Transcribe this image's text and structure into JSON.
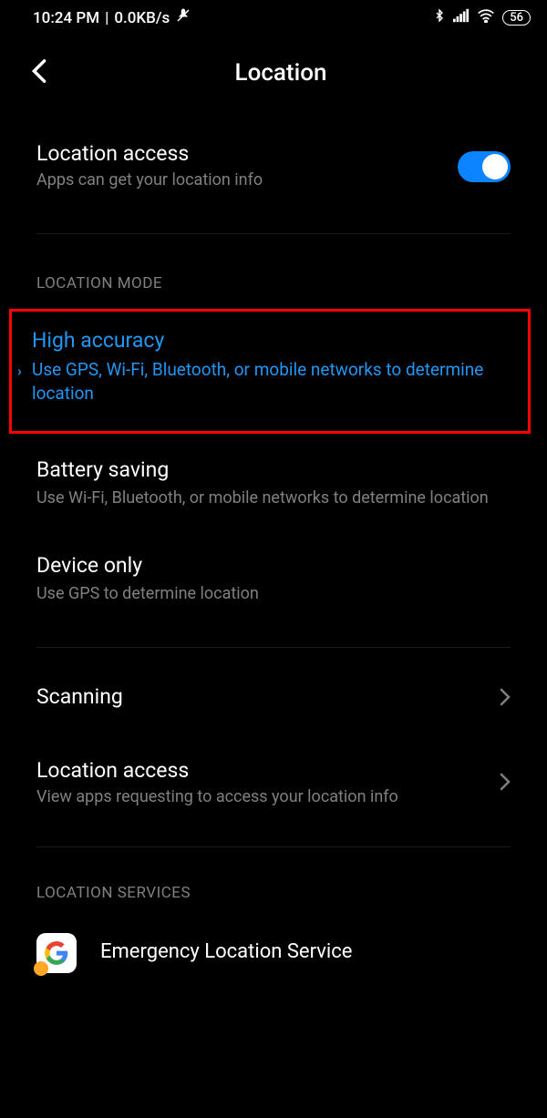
{
  "status": {
    "time": "10:24 PM",
    "speed": "0.0KB/s",
    "battery": "56"
  },
  "header": {
    "title": "Location"
  },
  "location_access": {
    "title": "Location access",
    "subtitle": "Apps can get your location info"
  },
  "sections": {
    "mode_header": "LOCATION MODE",
    "services_header": "LOCATION SERVICES"
  },
  "modes": {
    "high_accuracy": {
      "title": "High accuracy",
      "subtitle": "Use GPS, Wi-Fi, Bluetooth, or mobile networks to determine location"
    },
    "battery_saving": {
      "title": "Battery saving",
      "subtitle": "Use Wi-Fi, Bluetooth, or mobile networks to determine location"
    },
    "device_only": {
      "title": "Device only",
      "subtitle": "Use GPS to determine location"
    }
  },
  "nav": {
    "scanning": {
      "title": "Scanning"
    },
    "location_access_apps": {
      "title": "Location access",
      "subtitle": "View apps requesting to access your location info"
    }
  },
  "services": {
    "emergency": "Emergency Location Service"
  }
}
